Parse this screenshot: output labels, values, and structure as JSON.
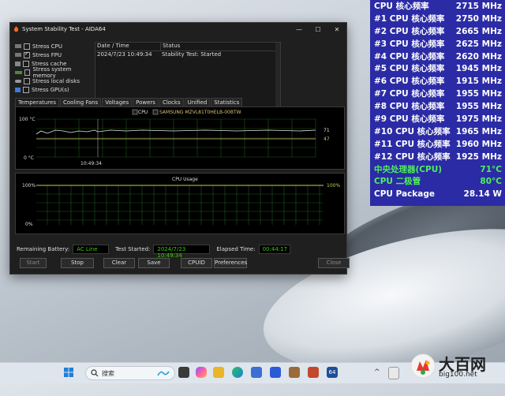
{
  "window": {
    "title": "System Stability Test - AIDA64",
    "stress_items": [
      {
        "label": "Stress CPU",
        "checked": false
      },
      {
        "label": "Stress FPU",
        "checked": true
      },
      {
        "label": "Stress cache",
        "checked": false
      },
      {
        "label": "Stress system memory",
        "checked": false
      },
      {
        "label": "Stress local disks",
        "checked": false
      },
      {
        "label": "Stress GPU(s)",
        "checked": false
      }
    ],
    "status_list": {
      "col_date": "Date / Time",
      "col_status": "Status",
      "rows": [
        {
          "date": "2024/7/23 10:49:34",
          "status": "Stability Test: Started"
        }
      ]
    },
    "tabs": [
      "Temperatures",
      "Cooling Fans",
      "Voltages",
      "Powers",
      "Clocks",
      "Unified",
      "Statistics"
    ],
    "temp_graph": {
      "legend_cpu": "CPU",
      "legend_ssd": "SAMSUNG MZVL81T0HELB-00BTW",
      "y_top": "100 °C",
      "y_bottom": "0 °C",
      "time_label": "10:49:34",
      "cpu_value": "71",
      "ssd_value": "47"
    },
    "usage_graph": {
      "title": "CPU Usage",
      "y_top": "100%",
      "y_bottom": "0%",
      "value": "100%"
    },
    "remaining_battery_label": "Remaining Battery:",
    "remaining_battery": "AC Line",
    "test_started_label": "Test Started:",
    "test_started": "2024/7/23 10:49:34",
    "elapsed_label": "Elapsed Time:",
    "elapsed": "00:44:17",
    "buttons": {
      "start": "Start",
      "stop": "Stop",
      "clear": "Clear",
      "save": "Save",
      "cpuid": "CPUID",
      "preferences": "Preferences",
      "close": "Close"
    }
  },
  "osd": {
    "rows": [
      {
        "k": "CPU 核心频率",
        "v": "2715 MHz"
      },
      {
        "k": "#1 CPU 核心频率",
        "v": "2750 MHz"
      },
      {
        "k": "#2 CPU 核心频率",
        "v": "2665 MHz"
      },
      {
        "k": "#3 CPU 核心频率",
        "v": "2625 MHz"
      },
      {
        "k": "#4 CPU 核心频率",
        "v": "2620 MHz"
      },
      {
        "k": "#5 CPU 核心频率",
        "v": "1945 MHz"
      },
      {
        "k": "#6 CPU 核心频率",
        "v": "1915 MHz"
      },
      {
        "k": "#7 CPU 核心频率",
        "v": "1955 MHz"
      },
      {
        "k": "#8 CPU 核心频率",
        "v": "1955 MHz"
      },
      {
        "k": "#9 CPU 核心频率",
        "v": "1975 MHz"
      },
      {
        "k": "#10 CPU 核心频率",
        "v": "1965 MHz"
      },
      {
        "k": "#11 CPU 核心频率",
        "v": "1960 MHz"
      },
      {
        "k": "#12 CPU 核心频率",
        "v": "1925 MHz"
      },
      {
        "k": "中央处理器(CPU)",
        "v": "71°C"
      },
      {
        "k": "CPU 二极管",
        "v": "80°C"
      },
      {
        "k": "CPU Package",
        "v": "28.14 W"
      }
    ]
  },
  "taskbar": {
    "search_placeholder": "搜索"
  },
  "watermark": {
    "title": "大百网",
    "url": "big100.net"
  }
}
